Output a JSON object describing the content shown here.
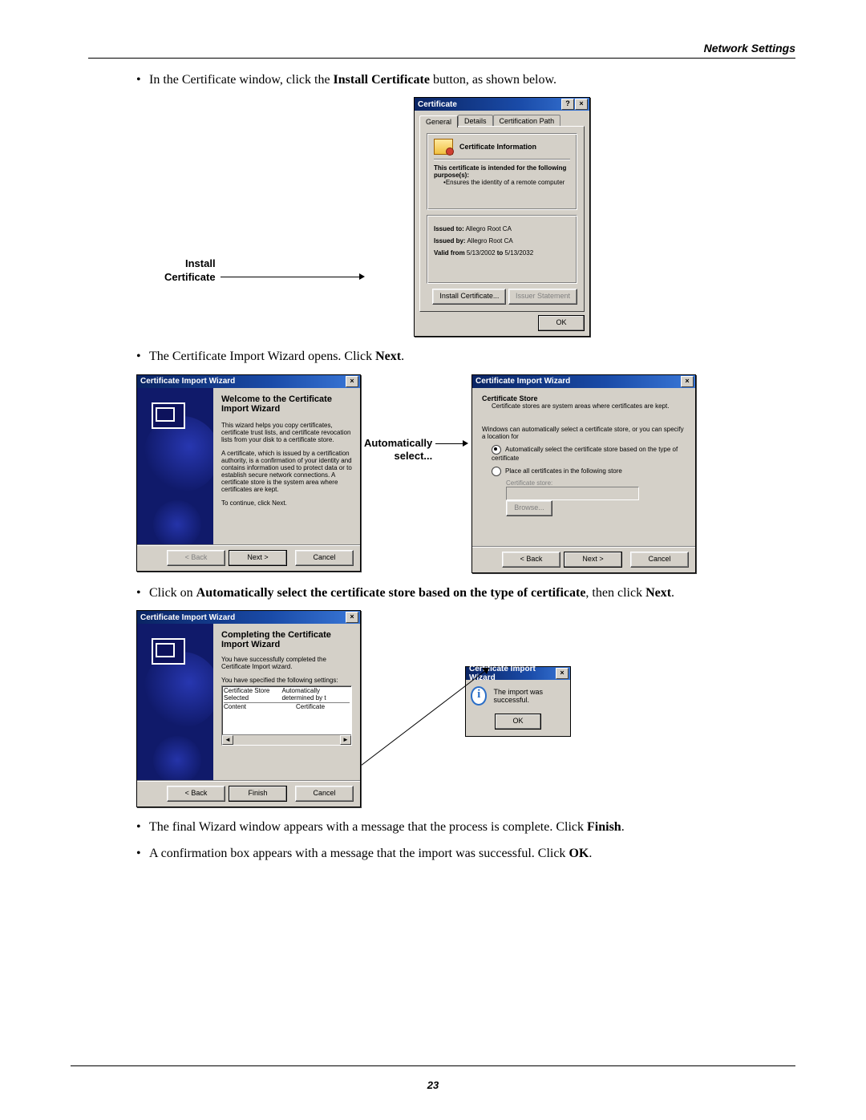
{
  "header": {
    "section_title": "Network Settings"
  },
  "bullets": [
    {
      "pre": "In the Certificate window, click the ",
      "bold": "Install Certificate",
      "post": " button, as shown below."
    },
    {
      "pre": "The Certificate Import Wizard opens. Click ",
      "bold": "Next",
      "post": "."
    },
    {
      "pre": "Click on ",
      "bold": "Automatically select the certificate store based on the type of certificate",
      "post": ", then click ",
      "bold2": "Next",
      "post2": "."
    },
    {
      "pre": "The final Wizard window appears with a message that the process is complete. Click ",
      "bold": "Finish",
      "post": "."
    },
    {
      "pre": "A confirmation box appears with a message that the import was successful. Click ",
      "bold": "OK",
      "post": "."
    }
  ],
  "callouts": {
    "install_certificate": "Install\nCertificate",
    "auto_select": "Automatically\nselect..."
  },
  "cert_dialog": {
    "title": "Certificate",
    "tabs": [
      "General",
      "Details",
      "Certification Path"
    ],
    "info_heading": "Certificate Information",
    "purpose_line": "This certificate is intended for the following purpose(s):",
    "purpose_item": "Ensures the identity of a remote computer",
    "issued_to_label": "Issued to:",
    "issued_to_value": "Allegro Root CA",
    "issued_by_label": "Issued by:",
    "issued_by_value": "Allegro Root CA",
    "valid_label": "Valid from",
    "valid_from": "5/13/2002",
    "valid_to_label": "to",
    "valid_to": "5/13/2032",
    "install_btn": "Install Certificate...",
    "issuer_btn": "Issuer Statement",
    "ok_btn": "OK"
  },
  "wizard_welcome": {
    "title": "Certificate Import Wizard",
    "heading": "Welcome to the Certificate Import Wizard",
    "p1": "This wizard helps you copy certificates, certificate trust lists, and certificate revocation lists from your disk to a certificate store.",
    "p2": "A certificate, which is issued by a certification authority, is a confirmation of your identity and contains information used to protect data or to establish secure network connections. A certificate store is the system area where certificates are kept.",
    "p3": "To continue, click Next.",
    "back": "< Back",
    "next": "Next >",
    "cancel": "Cancel"
  },
  "wizard_store": {
    "title": "Certificate Import Wizard",
    "heading": "Certificate Store",
    "sub": "Certificate stores are system areas where certificates are kept.",
    "p1": "Windows can automatically select a certificate store, or you can specify a location for",
    "opt1": "Automatically select the certificate store based on the type of certificate",
    "opt2": "Place all certificates in the following store",
    "store_label": "Certificate store:",
    "browse": "Browse...",
    "back": "< Back",
    "next": "Next >",
    "cancel": "Cancel"
  },
  "wizard_complete": {
    "title": "Certificate Import Wizard",
    "heading": "Completing the Certificate Import Wizard",
    "p1": "You have successfully completed the Certificate Import wizard.",
    "p2": "You have specified the following settings:",
    "col1a": "Certificate Store Selected",
    "col1b": "Content",
    "col2a": "Automatically determined by t",
    "col2b": "Certificate",
    "back": "< Back",
    "finish": "Finish",
    "cancel": "Cancel"
  },
  "msgbox": {
    "title": "Certificate Import Wizard",
    "msg": "The import was successful.",
    "ok": "OK"
  },
  "page_number": "23"
}
